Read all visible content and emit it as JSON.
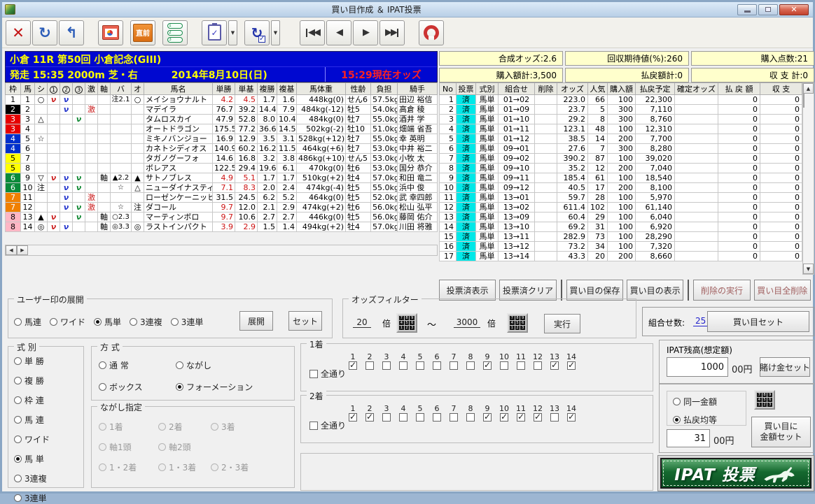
{
  "window": {
    "title": "買い目作成 ＆ IPAT投票"
  },
  "toolbar": {
    "glyph_close": "✕",
    "glyph_refresh": "↻",
    "glyph_undo": "↰",
    "label_chokuzen": "直前",
    "glyph_first": "◀◀",
    "glyph_prev": "◀",
    "glyph_next": "▶",
    "glyph_last": "▶▶",
    "dropdown_glyph": "▼"
  },
  "icons": {
    "numpad": [
      "7",
      "8",
      "9",
      "4",
      "5",
      "6",
      "1",
      "2",
      "3"
    ],
    "marks": [
      "1",
      "2",
      "3"
    ],
    "accent_red": "#cc1111",
    "accent_blue": "#2233cc",
    "accent_green": "#118833",
    "vote_cyan": "#00e8e8",
    "summary_yellow": "#ffffcc",
    "race_blue": "#0008d0"
  },
  "race": {
    "title": "小倉 11R 第50回  小倉記念(GIII)",
    "start": "発走 15:35 2000m  芝・右",
    "date": "2014年8月10日(日)",
    "odds_time": "15:29現在オッズ"
  },
  "summary": {
    "cells": [
      "合成オッズ:2.6",
      "回収期待値(%):260",
      "購入点数:21",
      "購入額計:3,500",
      "払戻額計:0",
      "収 支 計:0"
    ]
  },
  "horse_table": {
    "headers": [
      {
        "t": "枠"
      },
      {
        "t": "馬"
      },
      {
        "t": "シ"
      },
      {
        "t": "1",
        "cls": "circ"
      },
      {
        "t": "2",
        "cls": "circ"
      },
      {
        "t": "3",
        "cls": "circ"
      },
      {
        "t": "激"
      },
      {
        "t": "軸"
      },
      {
        "t": "バ"
      },
      {
        "t": "オ"
      },
      {
        "t": "馬名"
      },
      {
        "t": "単勝"
      },
      {
        "t": "単基"
      },
      {
        "t": "複勝"
      },
      {
        "t": "複基"
      },
      {
        "t": "馬体重"
      },
      {
        "t": "性齢"
      },
      {
        "t": "負担"
      },
      {
        "t": "騎手"
      }
    ],
    "rows": [
      {
        "w": "waku-1",
        "wn": "1",
        "u": "1",
        "shi": "○",
        "m1": "ν",
        "m2": "ν",
        "m3": "",
        "g": "",
        "j": "",
        "ba": "注2.1",
        "o": "○",
        "name": "メイショウナルト",
        "t": "4.2",
        "tc": "red",
        "tk": "4.5",
        "tkc": "red",
        "f": "1.7",
        "fk": "1.6",
        "wt": "448kg(0)",
        "sa": "せん6",
        "fu": "57.5kg",
        "jk": "田辺 裕信"
      },
      {
        "w": "waku-2",
        "wn": "2",
        "u": "2",
        "shi": "",
        "m1": "",
        "m2": "ν",
        "m3": "",
        "g": "激",
        "j": "",
        "ba": "",
        "o": "",
        "name": "マデイラ",
        "t": "76.7",
        "tc": "",
        "tk": "39.2",
        "tkc": "",
        "f": "14.4",
        "fk": "7.9",
        "wt": "484kg(-12)",
        "sa": "牡5",
        "fu": "54.0kg",
        "jk": "高倉 稜"
      },
      {
        "w": "waku-3",
        "wn": "3",
        "u": "3",
        "shi": "△",
        "m1": "",
        "m2": "",
        "m3": "ν",
        "g": "",
        "j": "",
        "ba": "",
        "o": "",
        "name": "タムロスカイ",
        "t": "47.9",
        "tc": "",
        "tk": "52.8",
        "tkc": "",
        "f": "8.0",
        "fk": "10.4",
        "wt": "484kg(0)",
        "sa": "牡7",
        "fu": "55.0kg",
        "jk": "酒井 学"
      },
      {
        "w": "waku-3",
        "wn": "3",
        "u": "4",
        "shi": "",
        "m1": "",
        "m2": "",
        "m3": "",
        "g": "",
        "j": "",
        "ba": "",
        "o": "",
        "name": "オートドラゴン",
        "t": "175.5",
        "tc": "",
        "tk": "77.2",
        "tkc": "",
        "f": "36.6",
        "fk": "14.5",
        "wt": "502kg(-2)",
        "sa": "牡10",
        "fu": "51.0kg",
        "jk": "畑端 省吾"
      },
      {
        "w": "waku-4",
        "wn": "4",
        "u": "5",
        "shi": "☆",
        "m1": "",
        "m2": "",
        "m3": "",
        "g": "",
        "j": "",
        "ba": "",
        "o": "",
        "name": "ミキノバンジョー",
        "t": "16.9",
        "tc": "",
        "tk": "12.9",
        "tkc": "",
        "f": "3.5",
        "fk": "3.1",
        "wt": "528kg(+12)",
        "sa": "牡7",
        "fu": "55.0kg",
        "jk": "幸 英明"
      },
      {
        "w": "waku-4",
        "wn": "4",
        "u": "6",
        "shi": "",
        "m1": "",
        "m2": "",
        "m3": "",
        "g": "",
        "j": "",
        "ba": "",
        "o": "",
        "name": "カネトシディオス",
        "t": "140.9",
        "tc": "",
        "tk": "60.2",
        "tkc": "",
        "f": "16.2",
        "fk": "11.5",
        "wt": "464kg(+6)",
        "sa": "牡7",
        "fu": "53.0kg",
        "jk": "中井 裕二"
      },
      {
        "w": "waku-5",
        "wn": "5",
        "u": "7",
        "shi": "",
        "m1": "",
        "m2": "",
        "m3": "",
        "g": "",
        "j": "",
        "ba": "",
        "o": "",
        "name": "タガノグーフォ",
        "t": "14.6",
        "tc": "",
        "tk": "16.8",
        "tkc": "",
        "f": "3.2",
        "fk": "3.8",
        "wt": "486kg(+10)",
        "sa": "せん5",
        "fu": "53.0kg",
        "jk": "小牧 太"
      },
      {
        "w": "waku-5",
        "wn": "5",
        "u": "8",
        "shi": "",
        "m1": "",
        "m2": "",
        "m3": "",
        "g": "",
        "j": "",
        "ba": "",
        "o": "",
        "name": "ボレアス",
        "t": "122.5",
        "tc": "",
        "tk": "29.4",
        "tkc": "",
        "f": "19.6",
        "fk": "6.1",
        "wt": "470kg(0)",
        "sa": "牡6",
        "fu": "53.0kg",
        "jk": "国分 恭介"
      },
      {
        "w": "waku-6",
        "wn": "6",
        "u": "9",
        "shi": "▽",
        "m1": "ν",
        "m2": "ν",
        "m3": "ν",
        "g": "",
        "j": "軸",
        "ba": "▲2.2",
        "o": "▲",
        "name": "サトノブレス",
        "t": "4.9",
        "tc": "red",
        "tk": "5.1",
        "tkc": "red",
        "f": "1.7",
        "fk": "1.7",
        "wt": "510kg(+2)",
        "sa": "牡4",
        "fu": "57.0kg",
        "jk": "和田 竜二"
      },
      {
        "w": "waku-6",
        "wn": "6",
        "u": "10",
        "shi": "注",
        "m1": "",
        "m2": "ν",
        "m3": "ν",
        "g": "",
        "j": "",
        "ba": "☆",
        "o": "△",
        "name": "ニューダイナスティ",
        "t": "7.1",
        "tc": "red",
        "tk": "8.3",
        "tkc": "red",
        "f": "2.0",
        "fk": "2.4",
        "wt": "474kg(-4)",
        "sa": "牡5",
        "fu": "55.0kg",
        "jk": "浜中 俊"
      },
      {
        "w": "waku-7",
        "wn": "7",
        "u": "11",
        "shi": "",
        "m1": "",
        "m2": "ν",
        "m3": "",
        "g": "激",
        "j": "",
        "ba": "",
        "o": "",
        "name": "ローゼンケーニッヒ",
        "t": "31.5",
        "tc": "",
        "tk": "24.5",
        "tkc": "",
        "f": "6.2",
        "fk": "5.2",
        "wt": "464kg(0)",
        "sa": "牡5",
        "fu": "52.0kg",
        "jk": "武 幸四郎"
      },
      {
        "w": "waku-7",
        "wn": "7",
        "u": "12",
        "shi": "",
        "m1": "",
        "m2": "ν",
        "m3": "ν",
        "g": "激",
        "j": "",
        "ba": "☆",
        "o": "注",
        "name": "ダコール",
        "t": "9.7",
        "tc": "red",
        "tk": "12.0",
        "tkc": "",
        "f": "2.1",
        "fk": "2.9",
        "wt": "474kg(+2)",
        "sa": "牡6",
        "fu": "56.0kg",
        "jk": "松山 弘平"
      },
      {
        "w": "waku-8",
        "wn": "8",
        "u": "13",
        "shi": "▲",
        "m1": "ν",
        "m2": "",
        "m3": "ν",
        "g": "",
        "j": "軸",
        "ba": "○2.3",
        "o": "",
        "name": "マーティンボロ",
        "t": "9.7",
        "tc": "red",
        "tk": "10.6",
        "tkc": "",
        "f": "2.7",
        "fk": "2.7",
        "wt": "446kg(0)",
        "sa": "牡5",
        "fu": "56.0kg",
        "jk": "藤岡 佑介"
      },
      {
        "w": "waku-8",
        "wn": "8",
        "u": "14",
        "shi": "◎",
        "m1": "ν",
        "m2": "ν",
        "m3": "",
        "g": "",
        "j": "軸",
        "ba": "◎3.3",
        "o": "◎",
        "name": "ラストインパクト",
        "t": "3.9",
        "tc": "red",
        "tk": "2.9",
        "tkc": "red",
        "f": "1.5",
        "fk": "1.4",
        "wt": "494kg(+2)",
        "sa": "牡4",
        "fu": "57.0kg",
        "jk": "川田 将雅"
      }
    ]
  },
  "bet_table": {
    "headers": [
      "No",
      "投票",
      "式別",
      "組合せ",
      "削除",
      "オッズ",
      "人気",
      "購入額",
      "払戻予定",
      "確定オッズ",
      "払 戻 額",
      "収  支"
    ],
    "rows": [
      {
        "no": "1",
        "v": "済",
        "ty": "馬単",
        "cb": "01→02",
        "del": "",
        "od": "223.0",
        "pp": "66",
        "am": "100",
        "ex": "22,300",
        "fx": "",
        "po": "0",
        "pl": "0"
      },
      {
        "no": "2",
        "v": "済",
        "ty": "馬単",
        "cb": "01→09",
        "del": "",
        "od": "23.7",
        "pp": "5",
        "am": "300",
        "ex": "7,110",
        "fx": "",
        "po": "0",
        "pl": "0"
      },
      {
        "no": "3",
        "v": "済",
        "ty": "馬単",
        "cb": "01→10",
        "del": "",
        "od": "29.2",
        "pp": "8",
        "am": "300",
        "ex": "8,760",
        "fx": "",
        "po": "0",
        "pl": "0"
      },
      {
        "no": "4",
        "v": "済",
        "ty": "馬単",
        "cb": "01→11",
        "del": "",
        "od": "123.1",
        "pp": "48",
        "am": "100",
        "ex": "12,310",
        "fx": "",
        "po": "0",
        "pl": "0"
      },
      {
        "no": "5",
        "v": "済",
        "ty": "馬単",
        "cb": "01→12",
        "del": "",
        "od": "38.5",
        "pp": "14",
        "am": "200",
        "ex": "7,700",
        "fx": "",
        "po": "0",
        "pl": "0"
      },
      {
        "no": "6",
        "v": "済",
        "ty": "馬単",
        "cb": "09→01",
        "del": "",
        "od": "27.6",
        "pp": "7",
        "am": "300",
        "ex": "8,280",
        "fx": "",
        "po": "0",
        "pl": "0"
      },
      {
        "no": "7",
        "v": "済",
        "ty": "馬単",
        "cb": "09→02",
        "del": "",
        "od": "390.2",
        "pp": "87",
        "am": "100",
        "ex": "39,020",
        "fx": "",
        "po": "0",
        "pl": "0"
      },
      {
        "no": "8",
        "v": "済",
        "ty": "馬単",
        "cb": "09→10",
        "del": "",
        "od": "35.2",
        "pp": "12",
        "am": "200",
        "ex": "7,040",
        "fx": "",
        "po": "0",
        "pl": "0"
      },
      {
        "no": "9",
        "v": "済",
        "ty": "馬単",
        "cb": "09→11",
        "del": "",
        "od": "185.4",
        "pp": "61",
        "am": "100",
        "ex": "18,540",
        "fx": "",
        "po": "0",
        "pl": "0"
      },
      {
        "no": "10",
        "v": "済",
        "ty": "馬単",
        "cb": "09→12",
        "del": "",
        "od": "40.5",
        "pp": "17",
        "am": "200",
        "ex": "8,100",
        "fx": "",
        "po": "0",
        "pl": "0"
      },
      {
        "no": "11",
        "v": "済",
        "ty": "馬単",
        "cb": "13→01",
        "del": "",
        "od": "59.7",
        "pp": "28",
        "am": "100",
        "ex": "5,970",
        "fx": "",
        "po": "0",
        "pl": "0"
      },
      {
        "no": "12",
        "v": "済",
        "ty": "馬単",
        "cb": "13→02",
        "del": "",
        "od": "611.4",
        "pp": "102",
        "am": "100",
        "ex": "61,140",
        "fx": "",
        "po": "0",
        "pl": "0"
      },
      {
        "no": "13",
        "v": "済",
        "ty": "馬単",
        "cb": "13→09",
        "del": "",
        "od": "60.4",
        "pp": "29",
        "am": "100",
        "ex": "6,040",
        "fx": "",
        "po": "0",
        "pl": "0"
      },
      {
        "no": "14",
        "v": "済",
        "ty": "馬単",
        "cb": "13→10",
        "del": "",
        "od": "69.2",
        "pp": "31",
        "am": "100",
        "ex": "6,920",
        "fx": "",
        "po": "0",
        "pl": "0"
      },
      {
        "no": "15",
        "v": "済",
        "ty": "馬単",
        "cb": "13→11",
        "del": "",
        "od": "282.9",
        "pp": "73",
        "am": "100",
        "ex": "28,290",
        "fx": "",
        "po": "0",
        "pl": "0"
      },
      {
        "no": "16",
        "v": "済",
        "ty": "馬単",
        "cb": "13→12",
        "del": "",
        "od": "73.2",
        "pp": "34",
        "am": "100",
        "ex": "7,320",
        "fx": "",
        "po": "0",
        "pl": "0"
      },
      {
        "no": "17",
        "v": "済",
        "ty": "馬単",
        "cb": "13→14",
        "del": "",
        "od": "43.3",
        "pp": "20",
        "am": "200",
        "ex": "8,660",
        "fx": "",
        "po": "0",
        "pl": "0"
      }
    ]
  },
  "actions": {
    "show_voted": "投票済表示",
    "clear_voted": "投票済クリア",
    "save_bets": "買い目の保存",
    "show_bets": "買い目の表示",
    "delete_exec": "削除の実行",
    "delete_all": "買い目全削除"
  },
  "user_mark": {
    "legend": "ユーザー印の展開",
    "options": [
      {
        "label": "馬連",
        "sel": false
      },
      {
        "label": "ワイド",
        "sel": false
      },
      {
        "label": "馬単",
        "sel": true
      },
      {
        "label": "3連複",
        "sel": false
      },
      {
        "label": "3連単",
        "sel": false
      }
    ],
    "expand": "展開",
    "set": "セット"
  },
  "odds_filter": {
    "legend": "オッズフィルター",
    "min": "20",
    "unit1": "倍",
    "tilde": "～",
    "max": "3000",
    "unit2": "倍",
    "exec": "実行"
  },
  "combo": {
    "label": "組合せ数:",
    "value": "25",
    "set_button": "買い目セット"
  },
  "shikibetsu": {
    "legend": "式 別",
    "options": [
      {
        "label": "単 勝",
        "sel": false
      },
      {
        "label": "複 勝",
        "sel": false
      },
      {
        "label": "枠 連",
        "sel": false
      },
      {
        "label": "馬 連",
        "sel": false
      },
      {
        "label": "ワイド",
        "sel": false
      },
      {
        "label": "馬 単",
        "sel": true
      },
      {
        "label": "3連複",
        "sel": false
      },
      {
        "label": "3連単",
        "sel": false
      }
    ]
  },
  "houshiki": {
    "legend": "方 式",
    "options": [
      {
        "label": "通 常",
        "sel": false,
        "cls": "w110"
      },
      {
        "label": "ながし",
        "sel": false,
        "cls": "w160"
      },
      {
        "label": "ボックス",
        "sel": false,
        "cls": "w110"
      },
      {
        "label": "フォーメーション",
        "sel": true,
        "cls": "w160"
      }
    ]
  },
  "nagashi": {
    "legend": "ながし指定",
    "options": [
      {
        "label": "1着",
        "cls": "w85 dis"
      },
      {
        "label": "2着",
        "cls": "w75 dis"
      },
      {
        "label": "3着",
        "cls": "w120 dis"
      },
      {
        "label": "軸1頭",
        "cls": "w85 dis"
      },
      {
        "label": "軸2頭",
        "cls": "w195 dis"
      },
      {
        "label": "1・2着",
        "cls": "w85 dis"
      },
      {
        "label": "1・3着",
        "cls": "w75 dis"
      },
      {
        "label": "2・3着",
        "cls": "w120 dis"
      }
    ]
  },
  "place1": {
    "legend": "1着",
    "all_label": "全通り",
    "all_checked": false,
    "nums": [
      {
        "n": "1",
        "c": true
      },
      {
        "n": "2",
        "c": false
      },
      {
        "n": "3",
        "c": false
      },
      {
        "n": "4",
        "c": false
      },
      {
        "n": "5",
        "c": false
      },
      {
        "n": "6",
        "c": false
      },
      {
        "n": "7",
        "c": false
      },
      {
        "n": "8",
        "c": false
      },
      {
        "n": "9",
        "c": true
      },
      {
        "n": "10",
        "c": false
      },
      {
        "n": "11",
        "c": false
      },
      {
        "n": "12",
        "c": false
      },
      {
        "n": "13",
        "c": true
      },
      {
        "n": "14",
        "c": true
      }
    ]
  },
  "place2": {
    "legend": "2着",
    "all_label": "全通り",
    "all_checked": false,
    "nums": [
      {
        "n": "1",
        "c": true
      },
      {
        "n": "2",
        "c": true
      },
      {
        "n": "3",
        "c": false
      },
      {
        "n": "4",
        "c": false
      },
      {
        "n": "5",
        "c": false
      },
      {
        "n": "6",
        "c": false
      },
      {
        "n": "7",
        "c": false
      },
      {
        "n": "8",
        "c": false
      },
      {
        "n": "9",
        "c": true
      },
      {
        "n": "10",
        "c": true
      },
      {
        "n": "11",
        "c": true
      },
      {
        "n": "12",
        "c": true
      },
      {
        "n": "13",
        "c": false
      },
      {
        "n": "14",
        "c": true
      }
    ]
  },
  "ipat_balance": {
    "label": "IPAT残高(想定額)",
    "value": "1000",
    "unit": "00円",
    "set_button": "賭け金セット"
  },
  "amount": {
    "options": [
      {
        "label": "同一金額",
        "sel": false
      },
      {
        "label": "払戻均等",
        "sel": true
      }
    ],
    "value": "31",
    "unit": "00円",
    "set_button_l1": "買い目に",
    "set_button_l2": "金額セット"
  },
  "ipat_vote": {
    "label": "IPAT 投票"
  }
}
